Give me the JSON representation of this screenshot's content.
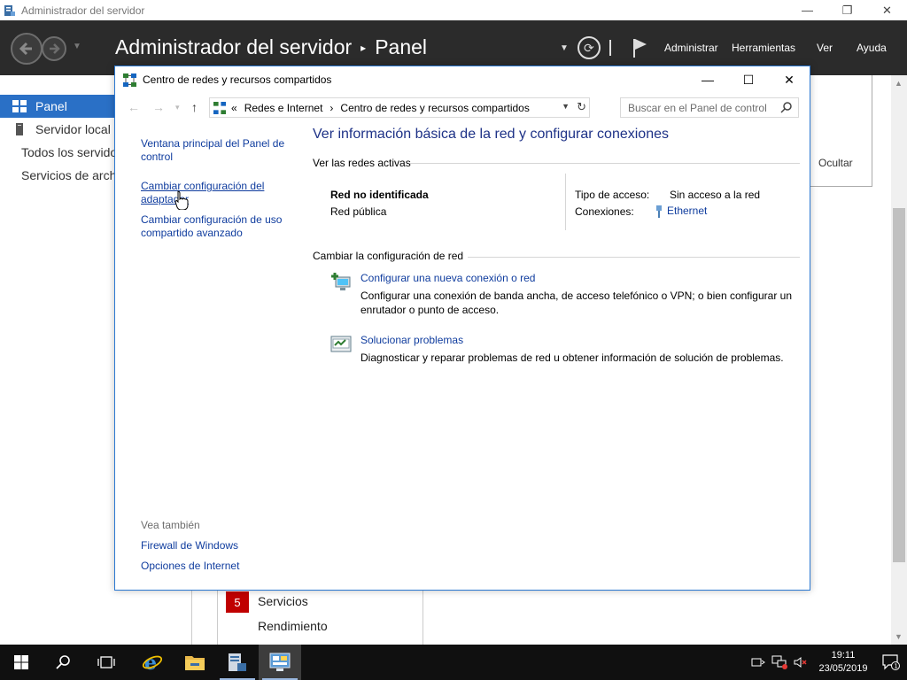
{
  "server_manager": {
    "window_title": "Administrador del servidor",
    "breadcrumb_root": "Administrador del servidor",
    "breadcrumb_sep": "▸",
    "breadcrumb_current": "Panel",
    "menu": {
      "manage": "Administrar",
      "tools": "Herramientas",
      "view": "Ver",
      "help": "Ayuda"
    },
    "sidebar": [
      {
        "label": "Panel"
      },
      {
        "label": "Servidor local"
      },
      {
        "label": "Todos los servidores"
      },
      {
        "label": "Servicios de archivos y almacenamiento"
      }
    ],
    "hide_label": "Ocultar",
    "bottom_tile": {
      "badge": "5",
      "services": "Servicios",
      "performance": "Rendimiento"
    }
  },
  "network_center": {
    "window_title": "Centro de redes y recursos compartidos",
    "address": {
      "prefix": "«",
      "seg1": "Redes e Internet",
      "arrow": "›",
      "seg2": "Centro de redes y recursos compartidos",
      "search_placeholder": "Buscar en el Panel de control"
    },
    "left_links": {
      "home": "Ventana principal del Panel de control",
      "adapter": "Cambiar configuración del adaptador",
      "sharing": "Cambiar configuración de uso compartido avanzado",
      "see_also": "Vea también",
      "firewall": "Firewall de Windows",
      "internet_options": "Opciones de Internet"
    },
    "heading": "Ver información básica de la red y configurar conexiones",
    "active_networks_title": "Ver las redes activas",
    "network": {
      "name": "Red no identificada",
      "profile": "Red pública",
      "access_type_label": "Tipo de acceso:",
      "access_type_value": "Sin acceso a la red",
      "connections_label": "Conexiones:",
      "connections_value": "Ethernet"
    },
    "change_settings_title": "Cambiar la configuración de red",
    "tasks": [
      {
        "icon": "new-connection-icon",
        "link": "Configurar una nueva conexión o red",
        "desc": "Configurar una conexión de banda ancha, de acceso telefónico o VPN; o bien configurar un enrutador o punto de acceso."
      },
      {
        "icon": "troubleshoot-icon",
        "link": "Solucionar problemas",
        "desc": "Diagnosticar y reparar problemas de red u obtener información de solución de problemas."
      }
    ]
  },
  "taskbar": {
    "time": "19:11",
    "date": "23/05/2019",
    "notification_count": "1"
  },
  "colors": {
    "accent": "#2a70c6",
    "link": "#0f3c9e",
    "heading": "#1e3287",
    "header_bg": "#2b2b2b",
    "badge_red": "#c00000"
  }
}
